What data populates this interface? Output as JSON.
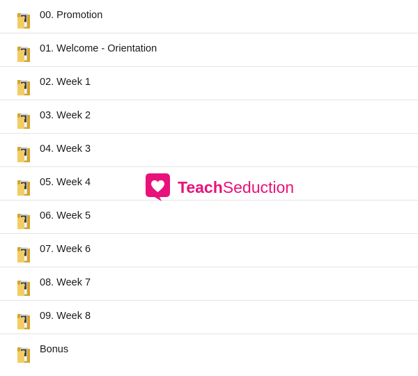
{
  "folders": [
    {
      "label": "00. Promotion",
      "icon": "folder-icon"
    },
    {
      "label": "01. Welcome - Orientation",
      "icon": "folder-icon"
    },
    {
      "label": "02. Week 1",
      "icon": "folder-icon"
    },
    {
      "label": "03. Week 2",
      "icon": "folder-icon"
    },
    {
      "label": "04. Week 3",
      "icon": "folder-icon"
    },
    {
      "label": "05. Week 4",
      "icon": "folder-icon"
    },
    {
      "label": "06. Week 5",
      "icon": "folder-icon"
    },
    {
      "label": "07. Week 6",
      "icon": "folder-icon"
    },
    {
      "label": "08. Week 7",
      "icon": "folder-icon"
    },
    {
      "label": "09. Week 8",
      "icon": "folder-icon"
    },
    {
      "label": "Bonus",
      "icon": "folder-icon"
    }
  ],
  "watermark": {
    "brand_bold": "Teach",
    "brand_regular": "Seduction",
    "icon": "heart-speech-bubble-icon",
    "color": "#e8127a"
  },
  "colors": {
    "folder_back": "#d9a520",
    "folder_front": "#f2cd63",
    "row_divider": "#e3e3e3"
  }
}
